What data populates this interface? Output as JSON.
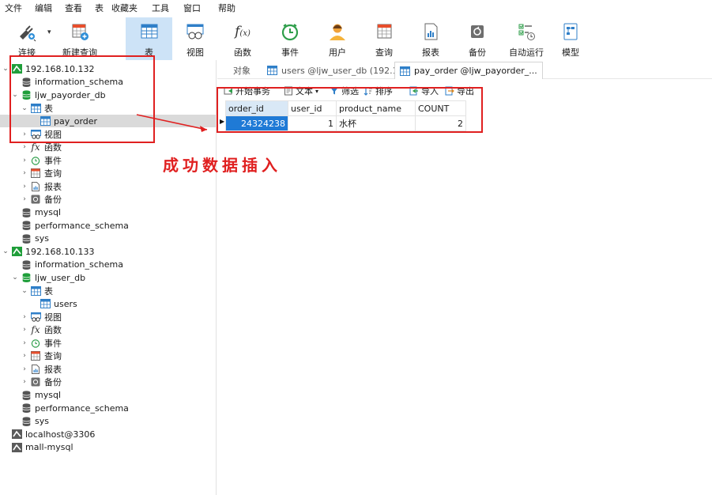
{
  "menu": [
    "文件",
    "编辑",
    "查看",
    "表",
    "收藏夹",
    "工具",
    "窗口",
    "帮助"
  ],
  "toolbar": [
    {
      "icon": "connection-icon",
      "label": "连接"
    },
    {
      "icon": "new-query-icon",
      "label": "新建查询"
    },
    {
      "icon": "table-icon",
      "label": "表",
      "active": true
    },
    {
      "icon": "view-icon",
      "label": "视图"
    },
    {
      "icon": "function-icon",
      "label": "函数"
    },
    {
      "icon": "event-icon",
      "label": "事件"
    },
    {
      "icon": "user-icon",
      "label": "用户"
    },
    {
      "icon": "query-icon",
      "label": "查询"
    },
    {
      "icon": "report-icon",
      "label": "报表"
    },
    {
      "icon": "backup-icon",
      "label": "备份"
    },
    {
      "icon": "automation-icon",
      "label": "自动运行"
    },
    {
      "icon": "model-icon",
      "label": "模型"
    }
  ],
  "tree": [
    {
      "text": "192.168.10.132",
      "icon": "server-green-icon",
      "chev": "⌄"
    },
    {
      "text": "information_schema",
      "icon": "database-icon"
    },
    {
      "text": "ljw_payorder_db",
      "icon": "database-green-icon",
      "chev": "⌄"
    },
    {
      "text": "表",
      "icon": "table-icon",
      "chev": "⌄"
    },
    {
      "text": "pay_order",
      "icon": "table-icon",
      "selected": true
    },
    {
      "text": "视图",
      "icon": "view-icon",
      "chev": "›"
    },
    {
      "text": "函数",
      "icon": "function-icon",
      "chev": "›"
    },
    {
      "text": "事件",
      "icon": "event-icon",
      "chev": "›"
    },
    {
      "text": "查询",
      "icon": "query-icon",
      "chev": "›"
    },
    {
      "text": "报表",
      "icon": "report-icon",
      "chev": "›"
    },
    {
      "text": "备份",
      "icon": "backup-icon",
      "chev": "›"
    },
    {
      "text": "mysql",
      "icon": "database-icon"
    },
    {
      "text": "performance_schema",
      "icon": "database-icon"
    },
    {
      "text": "sys",
      "icon": "database-icon"
    },
    {
      "text": "192.168.10.133",
      "icon": "server-green-icon",
      "chev": "⌄"
    },
    {
      "text": "information_schema",
      "icon": "database-icon"
    },
    {
      "text": "ljw_user_db",
      "icon": "database-green-icon",
      "chev": "⌄"
    },
    {
      "text": "表",
      "icon": "table-icon",
      "chev": "⌄"
    },
    {
      "text": "users",
      "icon": "table-icon"
    },
    {
      "text": "视图",
      "icon": "view-icon",
      "chev": "›"
    },
    {
      "text": "函数",
      "icon": "function-icon",
      "chev": "›"
    },
    {
      "text": "事件",
      "icon": "event-icon",
      "chev": "›"
    },
    {
      "text": "查询",
      "icon": "query-icon",
      "chev": "›"
    },
    {
      "text": "报表",
      "icon": "report-icon",
      "chev": "›"
    },
    {
      "text": "备份",
      "icon": "backup-icon",
      "chev": "›"
    },
    {
      "text": "mysql",
      "icon": "database-icon"
    },
    {
      "text": "performance_schema",
      "icon": "database-icon"
    },
    {
      "text": "sys",
      "icon": "database-icon"
    },
    {
      "text": "localhost@3306",
      "icon": "server-gray-icon"
    },
    {
      "text": "mall-mysql",
      "icon": "server-gray-icon"
    }
  ],
  "tabs": {
    "objects": "对象",
    "users_tab": "users @ljw_user_db (192.1...",
    "pay_order_tab": "pay_order @ljw_payorder_..."
  },
  "data_toolbar": {
    "begin_tx": "开始事务",
    "text": "文本",
    "filter": "筛选",
    "sort": "排序",
    "import": "导入",
    "export": "导出"
  },
  "grid": {
    "columns": [
      "order_id",
      "user_id",
      "product_name",
      "COUNT"
    ],
    "rows": [
      [
        "24324238",
        "1",
        "水杯",
        "2"
      ]
    ]
  },
  "annotation": {
    "text": "成功数据插入",
    "color": "#e02020"
  },
  "colors": {
    "accent": "#1f7ad6",
    "active_tool": "#cde3f7",
    "annotation": "#e02020"
  }
}
